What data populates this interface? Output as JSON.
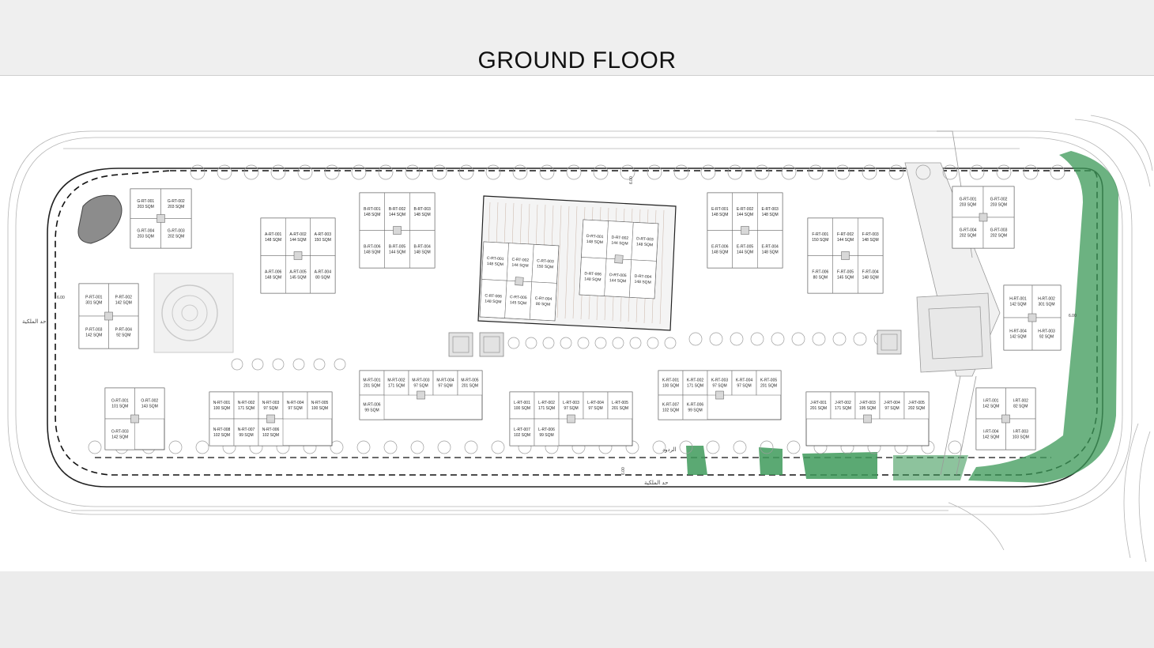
{
  "header": {
    "title": "GROUND FLOOR"
  },
  "colors": {
    "greenery": "#3e9a5a",
    "linework": "#9a9a9a",
    "boundary": "#111111",
    "unit_fill": "#ffffff"
  },
  "plan": {
    "dimensions": [
      "6.00",
      "6.00",
      "6.00",
      "6.00"
    ],
    "road_labels": [
      "حد الملكية",
      "الردود",
      "حد الملكية"
    ],
    "units": [
      {
        "code": "G-RT-001",
        "area": "203 SQM"
      },
      {
        "code": "G-RT-002",
        "area": "203 SQM"
      },
      {
        "code": "G-RT-004",
        "area": "203 SQM"
      },
      {
        "code": "G-RT-003",
        "area": "202 SQM"
      },
      {
        "code": "A-RT-001",
        "area": "148 SQM"
      },
      {
        "code": "A-RT-002",
        "area": "144 SQM"
      },
      {
        "code": "A-RT-003",
        "area": "150 SQM"
      },
      {
        "code": "A-RT-006",
        "area": "148 SQM"
      },
      {
        "code": "A-RT-005",
        "area": "145 SQM"
      },
      {
        "code": "A-RT-004",
        "area": "80 SQM"
      },
      {
        "code": "B-RT-001",
        "area": "148 SQM"
      },
      {
        "code": "B-RT-002",
        "area": "144 SQM"
      },
      {
        "code": "B-RT-003",
        "area": "148 SQM"
      },
      {
        "code": "B-RT-006",
        "area": "148 SQM"
      },
      {
        "code": "B-RT-005",
        "area": "144 SQM"
      },
      {
        "code": "B-RT-004",
        "area": "148 SQM"
      },
      {
        "code": "C-RT-001",
        "area": "148 SQM"
      },
      {
        "code": "C-RT-002",
        "area": "144 SQM"
      },
      {
        "code": "C-RT-003",
        "area": "150 SQM"
      },
      {
        "code": "C-RT-006",
        "area": "148 SQM"
      },
      {
        "code": "C-RT-005",
        "area": "145 SQM"
      },
      {
        "code": "C-RT-004",
        "area": "80 SQM"
      },
      {
        "code": "D-RT-001",
        "area": "148 SQM"
      },
      {
        "code": "D-RT-002",
        "area": "144 SQM"
      },
      {
        "code": "D-RT-003",
        "area": "148 SQM"
      },
      {
        "code": "D-RT-006",
        "area": "148 SQM"
      },
      {
        "code": "D-RT-005",
        "area": "144 SQM"
      },
      {
        "code": "D-RT-004",
        "area": "148 SQM"
      },
      {
        "code": "E-RT-001",
        "area": "148 SQM"
      },
      {
        "code": "E-RT-002",
        "area": "144 SQM"
      },
      {
        "code": "E-RT-003",
        "area": "148 SQM"
      },
      {
        "code": "E-RT-006",
        "area": "148 SQM"
      },
      {
        "code": "E-RT-005",
        "area": "144 SQM"
      },
      {
        "code": "E-RT-004",
        "area": "148 SQM"
      },
      {
        "code": "F-RT-001",
        "area": "150 SQM"
      },
      {
        "code": "F-RT-002",
        "area": "144 SQM"
      },
      {
        "code": "F-RT-003",
        "area": "148 SQM"
      },
      {
        "code": "F-RT-006",
        "area": "80 SQM"
      },
      {
        "code": "F-RT-005",
        "area": "145 SQM"
      },
      {
        "code": "F-RT-004",
        "area": "148 SQM"
      },
      {
        "code": "G-RT-001",
        "area": "203 SQM"
      },
      {
        "code": "G-RT-002",
        "area": "203 SQM"
      },
      {
        "code": "G-RT-004",
        "area": "202 SQM"
      },
      {
        "code": "G-RT-003",
        "area": "202 SQM"
      },
      {
        "code": "P-RT-001",
        "area": "301 SQM"
      },
      {
        "code": "P-RT-002",
        "area": "142 SQM"
      },
      {
        "code": "P-RT-003",
        "area": "142 SQM"
      },
      {
        "code": "P-RT-004",
        "area": "92 SQM"
      },
      {
        "code": "H-RT-001",
        "area": "142 SQM"
      },
      {
        "code": "H-RT-002",
        "area": "301 SQM"
      },
      {
        "code": "H-RT-004",
        "area": "142 SQM"
      },
      {
        "code": "H-RT-003",
        "area": "92 SQM"
      },
      {
        "code": "O-RT-001",
        "area": "101 SQM"
      },
      {
        "code": "O-RT-002",
        "area": "143 SQM"
      },
      {
        "code": "O-RT-003",
        "area": "142 SQM"
      },
      {
        "code": "N-RT-001",
        "area": "100 SQM"
      },
      {
        "code": "N-RT-002",
        "area": "171 SQM"
      },
      {
        "code": "N-RT-003",
        "area": "97 SQM"
      },
      {
        "code": "N-RT-004",
        "area": "97 SQM"
      },
      {
        "code": "N-RT-005",
        "area": "100 SQM"
      },
      {
        "code": "N-RT-008",
        "area": "102 SQM"
      },
      {
        "code": "N-RT-007",
        "area": "99 SQM"
      },
      {
        "code": "N-RT-006",
        "area": "102 SQM"
      },
      {
        "code": "M-RT-001",
        "area": "201 SQM"
      },
      {
        "code": "M-RT-002",
        "area": "171 SQM"
      },
      {
        "code": "M-RT-003",
        "area": "97 SQM"
      },
      {
        "code": "M-RT-004",
        "area": "97 SQM"
      },
      {
        "code": "M-RT-005",
        "area": "201 SQM"
      },
      {
        "code": "M-RT-006",
        "area": "99 SQM"
      },
      {
        "code": "L-RT-001",
        "area": "100 SQM"
      },
      {
        "code": "L-RT-002",
        "area": "171 SQM"
      },
      {
        "code": "L-RT-003",
        "area": "97 SQM"
      },
      {
        "code": "L-RT-004",
        "area": "97 SQM"
      },
      {
        "code": "L-RT-005",
        "area": "201 SQM"
      },
      {
        "code": "L-RT-007",
        "area": "102 SQM"
      },
      {
        "code": "L-RT-006",
        "area": "99 SQM"
      },
      {
        "code": "K-RT-001",
        "area": "100 SQM"
      },
      {
        "code": "K-RT-002",
        "area": "171 SQM"
      },
      {
        "code": "K-RT-003",
        "area": "97 SQM"
      },
      {
        "code": "K-RT-004",
        "area": "97 SQM"
      },
      {
        "code": "K-RT-005",
        "area": "201 SQM"
      },
      {
        "code": "K-RT-007",
        "area": "102 SQM"
      },
      {
        "code": "K-RT-006",
        "area": "99 SQM"
      },
      {
        "code": "J-RT-001",
        "area": "201 SQM"
      },
      {
        "code": "J-RT-002",
        "area": "171 SQM"
      },
      {
        "code": "J-RT-003",
        "area": "195 SQM"
      },
      {
        "code": "J-RT-004",
        "area": "97 SQM"
      },
      {
        "code": "J-RT-005",
        "area": "202 SQM"
      },
      {
        "code": "I-RT-001",
        "area": "142 SQM"
      },
      {
        "code": "I-RT-002",
        "area": "82 SQM"
      },
      {
        "code": "I-RT-004",
        "area": "142 SQM"
      },
      {
        "code": "I-RT-003",
        "area": "103 SQM"
      }
    ]
  }
}
